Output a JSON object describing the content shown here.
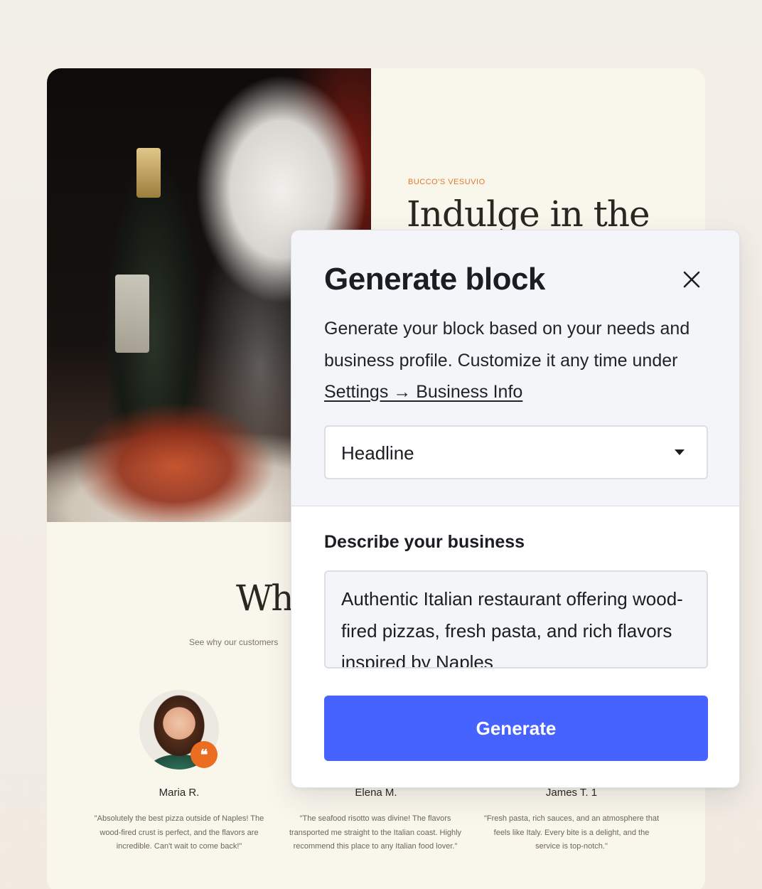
{
  "site": {
    "eyebrow": "BUCCO'S VESUVIO",
    "hero_title": "Indulge in the",
    "testimonials_title": "Wha",
    "testimonials_subtitle": "See why our customers",
    "testimonials": [
      {
        "name": "Maria R.",
        "quote": "\"Absolutely the best pizza outside of Naples! The wood-fired crust is perfect, and the flavors are incredible. Can't wait to come back!\""
      },
      {
        "name": "Elena M.",
        "quote": "\"The seafood risotto was divine! The flavors transported me straight to the Italian coast. Highly recommend this place to any Italian food lover.\""
      },
      {
        "name": "James T. 1",
        "quote": "\"Fresh pasta, rich sauces, and an atmosphere that feels like Italy. Every bite is a delight, and the service is top-notch.\""
      }
    ],
    "quote_badge": "66",
    "accent_color": "#ea6d22"
  },
  "modal": {
    "title": "Generate block",
    "close_icon": "close-icon",
    "description": "Generate your block based on your needs and business profile. Customize it any time under",
    "settings_link": "Settings → Business Info",
    "block_type": {
      "selected": "Headline",
      "icon": "caret-down-icon"
    },
    "describe_label": "Describe your business",
    "describe_value": "Authentic Italian restaurant offering wood-fired pizzas, fresh pasta, and rich flavors inspired by Naples",
    "generate_label": "Generate",
    "button_color": "#4763ff"
  }
}
